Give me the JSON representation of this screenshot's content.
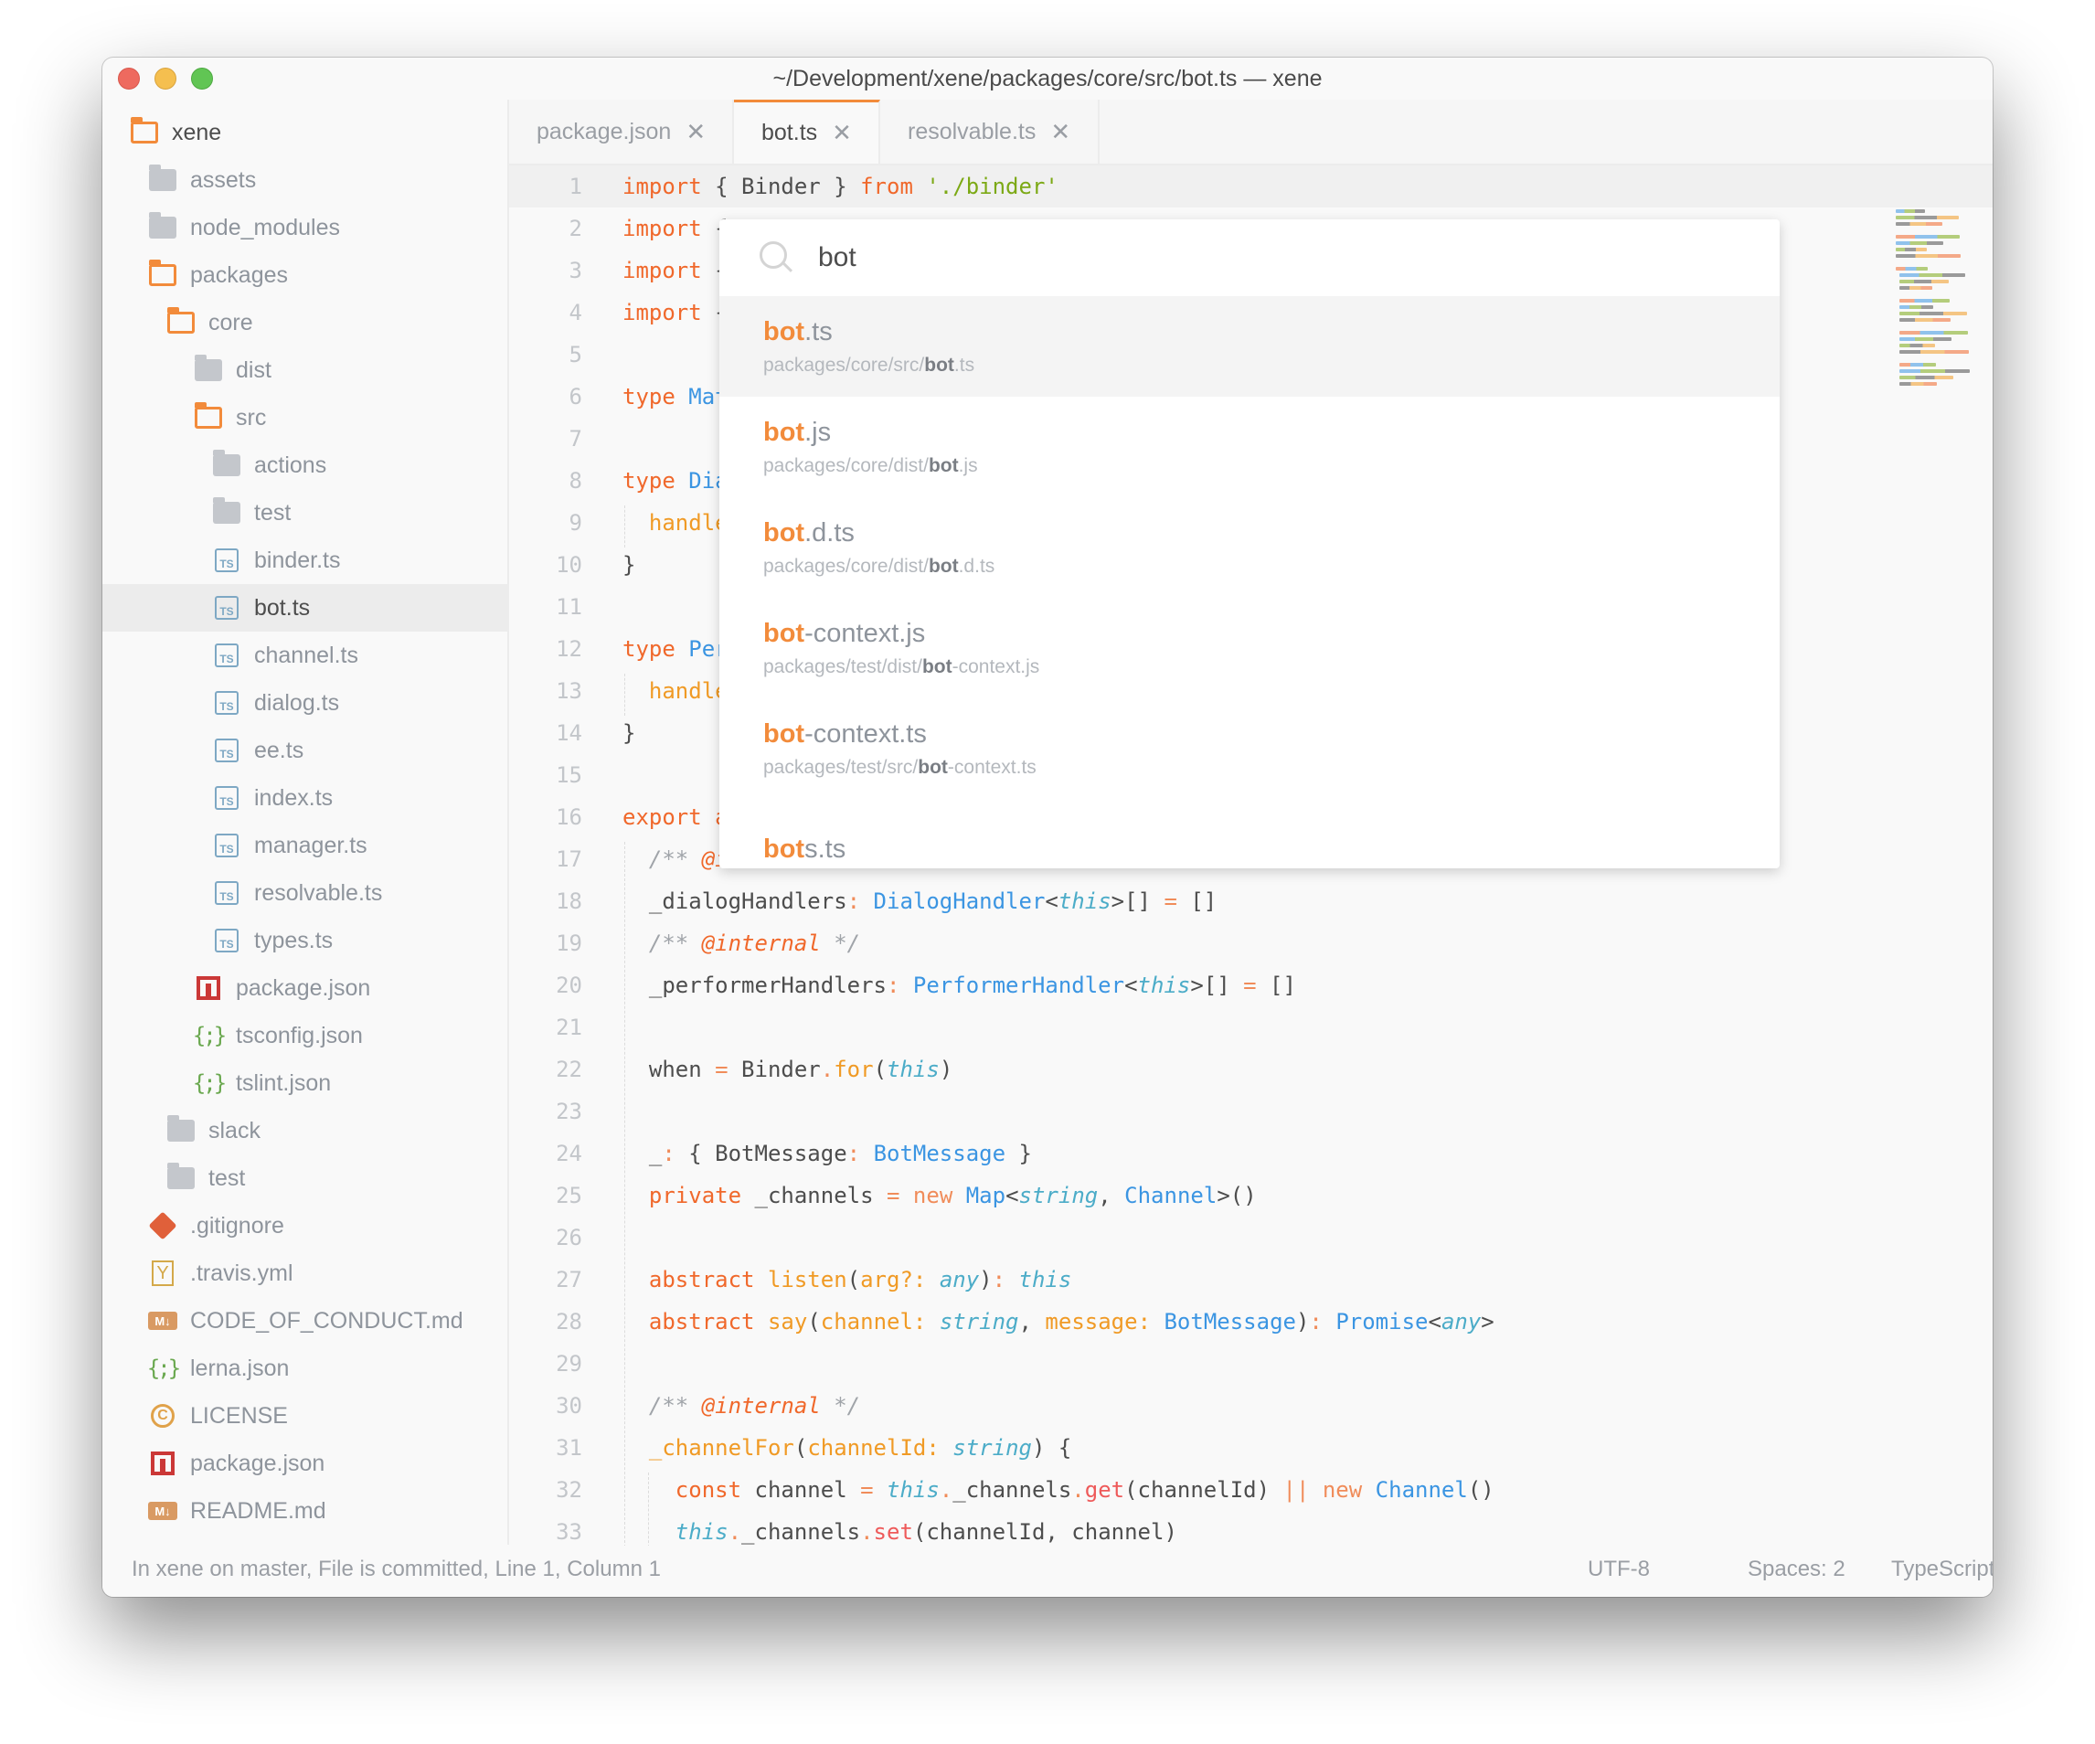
{
  "window": {
    "title": "~/Development/xene/packages/core/src/bot.ts — xene"
  },
  "sidebar": {
    "items": [
      {
        "label": "xene",
        "icon": "folder-open-icon",
        "depth": 0,
        "root": true
      },
      {
        "label": "assets",
        "icon": "folder-icon",
        "depth": 1
      },
      {
        "label": "node_modules",
        "icon": "folder-icon",
        "depth": 1
      },
      {
        "label": "packages",
        "icon": "folder-open-icon",
        "depth": 1
      },
      {
        "label": "core",
        "icon": "folder-open-icon",
        "depth": 2
      },
      {
        "label": "dist",
        "icon": "folder-icon",
        "depth": 3
      },
      {
        "label": "src",
        "icon": "folder-open-icon",
        "depth": 3
      },
      {
        "label": "actions",
        "icon": "folder-icon",
        "depth": 4
      },
      {
        "label": "test",
        "icon": "folder-icon",
        "depth": 4
      },
      {
        "label": "binder.ts",
        "icon": "typescript-icon",
        "depth": 4
      },
      {
        "label": "bot.ts",
        "icon": "typescript-icon",
        "depth": 4,
        "selected": true
      },
      {
        "label": "channel.ts",
        "icon": "typescript-icon",
        "depth": 4
      },
      {
        "label": "dialog.ts",
        "icon": "typescript-icon",
        "depth": 4
      },
      {
        "label": "ee.ts",
        "icon": "typescript-icon",
        "depth": 4
      },
      {
        "label": "index.ts",
        "icon": "typescript-icon",
        "depth": 4
      },
      {
        "label": "manager.ts",
        "icon": "typescript-icon",
        "depth": 4
      },
      {
        "label": "resolvable.ts",
        "icon": "typescript-icon",
        "depth": 4
      },
      {
        "label": "types.ts",
        "icon": "typescript-icon",
        "depth": 4
      },
      {
        "label": "package.json",
        "icon": "npm-icon",
        "depth": 3
      },
      {
        "label": "tsconfig.json",
        "icon": "json-icon",
        "depth": 3
      },
      {
        "label": "tslint.json",
        "icon": "json-icon",
        "depth": 3
      },
      {
        "label": "slack",
        "icon": "folder-icon",
        "depth": 2
      },
      {
        "label": "test",
        "icon": "folder-icon",
        "depth": 2
      },
      {
        "label": ".gitignore",
        "icon": "git-icon",
        "depth": 1
      },
      {
        "label": ".travis.yml",
        "icon": "yaml-icon",
        "depth": 1
      },
      {
        "label": "CODE_OF_CONDUCT.md",
        "icon": "markdown-icon",
        "depth": 1
      },
      {
        "label": "lerna.json",
        "icon": "json-icon",
        "depth": 1
      },
      {
        "label": "LICENSE",
        "icon": "license-icon",
        "depth": 1
      },
      {
        "label": "package.json",
        "icon": "npm-icon",
        "depth": 1
      },
      {
        "label": "README.md",
        "icon": "markdown-icon",
        "depth": 1
      }
    ]
  },
  "tabs": [
    {
      "label": "package.json",
      "active": false
    },
    {
      "label": "bot.ts",
      "active": true
    },
    {
      "label": "resolvable.ts",
      "active": false
    }
  ],
  "editor": {
    "lines": [
      {
        "n": "1",
        "html": "<span class='kw'>import</span> { Binder } <span class='kw'>from</span> <span class='str'>'./binder'</span>"
      },
      {
        "n": "2",
        "html": "<span class='kw'>import</span> { D"
      },
      {
        "n": "3",
        "html": "<span class='kw'>import</span> { C"
      },
      {
        "n": "4",
        "html": "<span class='kw'>import</span> { U"
      },
      {
        "n": "5",
        "html": ""
      },
      {
        "n": "6",
        "html": "<span class='kw'>type</span> <span class='ty'>Match</span>"
      },
      {
        "n": "7",
        "html": ""
      },
      {
        "n": "8",
        "html": "<span class='kw'>type</span> <span class='ty'>Dialo</span>"
      },
      {
        "n": "9",
        "html": "  <span class='prop'>handler</span>"
      },
      {
        "n": "10",
        "html": "}"
      },
      {
        "n": "11",
        "html": ""
      },
      {
        "n": "12",
        "html": "<span class='kw'>type</span> <span class='ty'>Perfo</span>"
      },
      {
        "n": "13",
        "html": "  <span class='prop'>handler</span>"
      },
      {
        "n": "14",
        "html": "}"
      },
      {
        "n": "15",
        "html": ""
      },
      {
        "n": "16",
        "html": "<span class='kw'>export abs</span>"
      },
      {
        "n": "17",
        "html": "  <span class='cm'>/** </span><span class='cmtag'>@int</span>"
      },
      {
        "n": "18",
        "html": "  _dialogHandlers<span class='op'>:</span> <span class='ty'>DialogHandler</span>&lt;<span class='it'>this</span>&gt;[] <span class='op'>=</span> []"
      },
      {
        "n": "19",
        "html": "  <span class='cm'>/** </span><span class='cmtag'>@internal</span><span class='cm'> */</span>"
      },
      {
        "n": "20",
        "html": "  _performerHandlers<span class='op'>:</span> <span class='ty'>PerformerHandler</span>&lt;<span class='it'>this</span>&gt;[] <span class='op'>=</span> []"
      },
      {
        "n": "21",
        "html": ""
      },
      {
        "n": "22",
        "html": "  when <span class='op'>=</span> Binder<span class='op'>.</span><span class='fn'>for</span>(<span class='it'>this</span>)"
      },
      {
        "n": "23",
        "html": ""
      },
      {
        "n": "24",
        "html": "  _<span class='op'>:</span> { BotMessage<span class='op'>:</span> <span class='ty'>BotMessage</span> }"
      },
      {
        "n": "25",
        "html": "  <span class='kw'>private</span> _channels <span class='op'>=</span> <span class='op'>new</span> <span class='ty'>Map</span>&lt;<span class='it'>string</span>, <span class='ty'>Channel</span>&gt;()"
      },
      {
        "n": "26",
        "html": ""
      },
      {
        "n": "27",
        "html": "  <span class='kw'>abstract</span> <span class='fn'>listen</span>(<span class='prop'>arg?:</span> <span class='it'>any</span>)<span class='op'>:</span> <span class='it'>this</span>"
      },
      {
        "n": "28",
        "html": "  <span class='kw'>abstract</span> <span class='fn'>say</span>(<span class='prop'>channel:</span> <span class='it'>string</span>, <span class='prop'>message:</span> <span class='ty'>BotMessage</span>)<span class='op'>:</span> <span class='ty'>Promise</span>&lt;<span class='it'>any</span>&gt;"
      },
      {
        "n": "29",
        "html": ""
      },
      {
        "n": "30",
        "html": "  <span class='cm'>/** </span><span class='cmtag'>@internal</span><span class='cm'> */</span>"
      },
      {
        "n": "31",
        "html": "  <span class='fn'>_channelFor</span>(<span class='prop'>channelId:</span> <span class='it'>string</span>) {"
      },
      {
        "n": "32",
        "html": "    <span class='kw'>const</span> channel <span class='op'>=</span> <span class='it'>this</span><span class='op'>.</span>_channels<span class='op'>.</span><span class='meth'>get</span>(channelId) <span class='op'>||</span> <span class='op'>new</span> <span class='ty'>Channel</span>()"
      },
      {
        "n": "33",
        "html": "    <span class='it'>this</span><span class='op'>.</span>_channels<span class='op'>.</span><span class='meth'>set</span>(channelId, channel)"
      }
    ]
  },
  "finder": {
    "query": "bot",
    "placeholder": "",
    "results": [
      {
        "match": "bot",
        "rest": ".ts",
        "path_prefix": "packages/core/src/",
        "path_match": "bot",
        "path_rest": ".ts",
        "selected": true
      },
      {
        "match": "bot",
        "rest": ".js",
        "path_prefix": "packages/core/dist/",
        "path_match": "bot",
        "path_rest": ".js"
      },
      {
        "match": "bot",
        "rest": ".d.ts",
        "path_prefix": "packages/core/dist/",
        "path_match": "bot",
        "path_rest": ".d.ts"
      },
      {
        "match": "bot",
        "rest": "-context.js",
        "path_prefix": "packages/test/dist/",
        "path_match": "bot",
        "path_rest": "-context.js"
      },
      {
        "match": "bot",
        "rest": "-context.ts",
        "path_prefix": "packages/test/src/",
        "path_match": "bot",
        "path_rest": "-context.ts"
      },
      {
        "match": "bot",
        "rest": "s.ts",
        "path_prefix": "",
        "path_match": "",
        "path_rest": ""
      }
    ]
  },
  "statusbar": {
    "left": "In xene on master, File is committed, Line 1, Column 1",
    "encoding": "UTF-8",
    "indent": "Spaces: 2",
    "grammar": "TypeScript"
  },
  "colors": {
    "accent": "#f28b3b",
    "keyword": "#f0682b",
    "type": "#3b95e2",
    "string": "#7ca915"
  }
}
